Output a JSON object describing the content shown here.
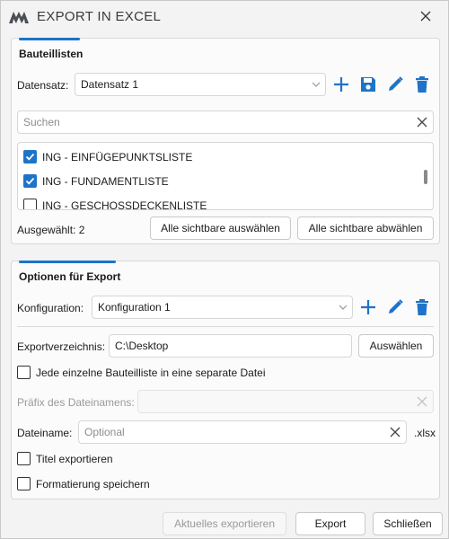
{
  "window": {
    "title": "EXPORT IN EXCEL"
  },
  "bauteillisten": {
    "section_title": "Bauteillisten",
    "datensatz_label": "Datensatz:",
    "datensatz_value": "Datensatz 1",
    "search_placeholder": "Suchen",
    "items": [
      {
        "label": "ING - EINFÜGEPUNKTSLISTE",
        "checked": true
      },
      {
        "label": "ING - FUNDAMENTLISTE",
        "checked": true
      },
      {
        "label": "ING - GESCHOSSDECKENLISTE",
        "checked": false
      }
    ],
    "selected_count": "Ausgewählt: 2",
    "select_all_label": "Alle sichtbare auswählen",
    "deselect_all_label": "Alle sichtbare abwählen"
  },
  "export_options": {
    "section_title": "Optionen für Export",
    "konfiguration_label": "Konfiguration:",
    "konfiguration_value": "Konfiguration 1",
    "exportverzeichnis_label": "Exportverzeichnis:",
    "exportverzeichnis_value": "C:\\Desktop",
    "choose_label": "Auswählen",
    "separate_file_label": "Jede einzelne Bauteilliste in eine separate Datei",
    "separate_file_checked": false,
    "prefix_label": "Präfix des Dateinamens:",
    "prefix_value": "",
    "dateiname_label": "Dateiname:",
    "dateiname_placeholder": "Optional",
    "extension": ".xlsx",
    "titel_label": "Titel exportieren",
    "titel_checked": false,
    "format_label": "Formatierung speichern",
    "format_checked": false
  },
  "footer": {
    "export_current_label": "Aktuelles exportieren",
    "export_label": "Export",
    "close_label": "Schließen"
  },
  "colors": {
    "accent": "#1e73c8",
    "brand": "#4a4f55"
  }
}
